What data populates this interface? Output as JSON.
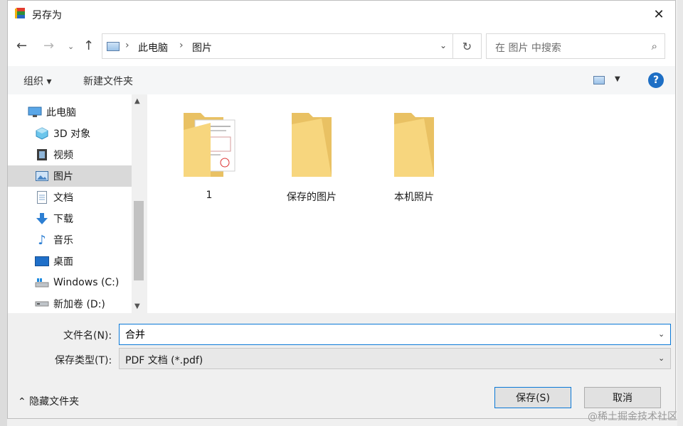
{
  "window": {
    "title": "另存为",
    "close_symbol": "✕"
  },
  "nav": {
    "back_symbol": "←",
    "forward_symbol": "→",
    "recent_symbol": "⌄",
    "up_symbol": "↑",
    "breadcrumb": [
      "此电脑",
      "图片"
    ],
    "breadcrumb_separator": "›",
    "dropdown_symbol": "⌄",
    "refresh_symbol": "↻"
  },
  "search": {
    "placeholder": "在 图片 中搜索",
    "icon": "search-icon"
  },
  "toolbar": {
    "organize_label": "组织 ▾",
    "new_folder_label": "新建文件夹",
    "view_dropdown": "▼",
    "help_label": "?"
  },
  "sidebar": {
    "items": [
      {
        "label": "此电脑",
        "icon": "computer-icon",
        "selected": false
      },
      {
        "label": "3D 对象",
        "icon": "cube-icon",
        "selected": false
      },
      {
        "label": "视频",
        "icon": "video-icon",
        "selected": false
      },
      {
        "label": "图片",
        "icon": "picture-icon",
        "selected": true
      },
      {
        "label": "文档",
        "icon": "document-icon",
        "selected": false
      },
      {
        "label": "下载",
        "icon": "download-icon",
        "selected": false
      },
      {
        "label": "音乐",
        "icon": "music-icon",
        "selected": false
      },
      {
        "label": "桌面",
        "icon": "desktop-icon",
        "selected": false
      },
      {
        "label": "Windows (C:)",
        "icon": "drive-c-icon",
        "selected": false
      },
      {
        "label": "新加卷 (D:)",
        "icon": "drive-d-icon",
        "selected": false
      }
    ],
    "scroll_up_symbol": "▲",
    "scroll_down_symbol": "▼"
  },
  "folders": [
    {
      "label": "1",
      "has_preview": true
    },
    {
      "label": "保存的图片",
      "has_preview": false
    },
    {
      "label": "本机照片",
      "has_preview": false
    }
  ],
  "form": {
    "filename_label": "文件名(N):",
    "filename_value": "合并",
    "filetype_label": "保存类型(T):",
    "filetype_value": "PDF 文档 (*.pdf)",
    "dropdown_symbol": "⌄"
  },
  "footer": {
    "hide_folders_label": "⌃  隐藏文件夹",
    "save_label": "保存(S)",
    "cancel_label": "取消"
  },
  "watermark": "@稀土掘金技术社区"
}
